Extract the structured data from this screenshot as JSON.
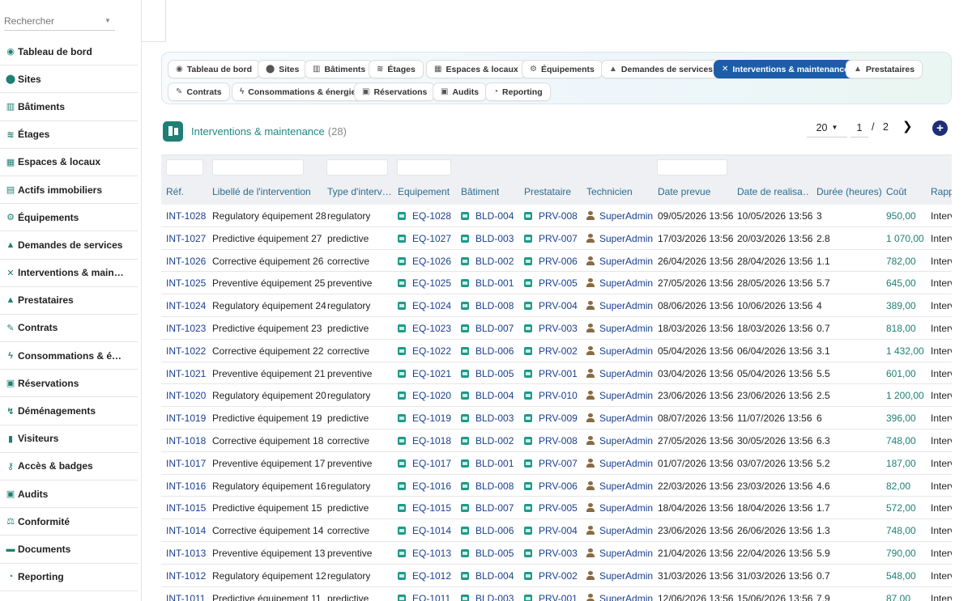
{
  "search": {
    "placeholder": "Rechercher"
  },
  "sidebar": {
    "items": [
      {
        "label": "Tableau de bord",
        "icon": "dashboard-icon",
        "glyph": "◉"
      },
      {
        "label": "Sites",
        "icon": "map-pin-icon",
        "glyph": "⬤"
      },
      {
        "label": "Bâtiments",
        "icon": "building-icon",
        "glyph": "▥"
      },
      {
        "label": "Étages",
        "icon": "layers-icon",
        "glyph": "≋"
      },
      {
        "label": "Espaces & locaux",
        "icon": "grid-icon",
        "glyph": "▦"
      },
      {
        "label": "Actifs immobiliers",
        "icon": "assets-icon",
        "glyph": "▤"
      },
      {
        "label": "Équipements",
        "icon": "gears-icon",
        "glyph": "⚙"
      },
      {
        "label": "Demandes de services",
        "icon": "bell-icon",
        "glyph": "▲"
      },
      {
        "label": "Interventions & main…",
        "icon": "tools-icon",
        "glyph": "✕"
      },
      {
        "label": "Prestataires",
        "icon": "hardhat-icon",
        "glyph": "▲"
      },
      {
        "label": "Contrats",
        "icon": "contract-icon",
        "glyph": "✎"
      },
      {
        "label": "Consommations & é…",
        "icon": "bolt-icon",
        "glyph": "ϟ"
      },
      {
        "label": "Réservations",
        "icon": "calendar-icon",
        "glyph": "▣"
      },
      {
        "label": "Déménagements",
        "icon": "truck-icon",
        "glyph": "↯"
      },
      {
        "label": "Visiteurs",
        "icon": "badge-icon",
        "glyph": "▮"
      },
      {
        "label": "Accès & badges",
        "icon": "key-icon",
        "glyph": "⚷"
      },
      {
        "label": "Audits",
        "icon": "clipboard-icon",
        "glyph": "▣"
      },
      {
        "label": "Conformité",
        "icon": "scale-icon",
        "glyph": "⚖"
      },
      {
        "label": "Documents",
        "icon": "folder-icon",
        "glyph": "▬"
      },
      {
        "label": "Reporting",
        "icon": "chart-pie-icon",
        "glyph": "◔"
      }
    ]
  },
  "module_tabs": [
    {
      "label": "Tableau de bord",
      "icon": "dashboard-icon",
      "glyph": "◉",
      "active": false
    },
    {
      "label": "Sites",
      "icon": "map-pin-icon",
      "glyph": "⬤",
      "active": false
    },
    {
      "label": "Bâtiments",
      "icon": "building-icon",
      "glyph": "▥",
      "active": false
    },
    {
      "label": "Étages",
      "icon": "layers-icon",
      "glyph": "≋",
      "active": false
    },
    {
      "label": "Espaces & locaux",
      "icon": "grid-icon",
      "glyph": "▦",
      "active": false
    },
    {
      "label": "Équipements",
      "icon": "gears-icon",
      "glyph": "⚙",
      "active": false
    },
    {
      "label": "Demandes de services",
      "icon": "bell-icon",
      "glyph": "▲",
      "active": false
    },
    {
      "label": "Interventions & maintenance",
      "icon": "tools-icon",
      "glyph": "✕",
      "active": true
    },
    {
      "label": "Prestataires",
      "icon": "hardhat-icon",
      "glyph": "▲",
      "active": false
    },
    {
      "label": "Contrats",
      "icon": "contract-icon",
      "glyph": "✎",
      "active": false
    },
    {
      "label": "Consommations & énergie",
      "icon": "bolt-icon",
      "glyph": "ϟ",
      "active": false
    },
    {
      "label": "Réservations",
      "icon": "calendar-icon",
      "glyph": "▣",
      "active": false
    },
    {
      "label": "Audits",
      "icon": "clipboard-icon",
      "glyph": "▣",
      "active": false
    },
    {
      "label": "Reporting",
      "icon": "chart-pie-icon",
      "glyph": "◔",
      "active": false
    }
  ],
  "page": {
    "title": "Interventions & maintenance",
    "count": "(28)"
  },
  "pager": {
    "page_size": "20",
    "current_page": "1",
    "separator": "/",
    "total_pages": "2",
    "next_glyph": "❯",
    "add_glyph": "+"
  },
  "table": {
    "columns": [
      "Réf.",
      "Libellé de l'intervention",
      "Type d'interv…",
      "Equipement",
      "Bâtiment",
      "Prestataire",
      "Technicien",
      "Date prevue",
      "Date de realisa…",
      "Durée (heures)",
      "Coût",
      "Rapp"
    ],
    "rows": [
      [
        "INT-1028",
        "Regulatory équipement 28",
        "regulatory",
        "EQ-1028",
        "BLD-004",
        "PRV-008",
        "SuperAdmin",
        "09/05/2026 13:56",
        "10/05/2026 13:56",
        "3",
        "950,00",
        "Interv"
      ],
      [
        "INT-1027",
        "Predictive équipement 27",
        "predictive",
        "EQ-1027",
        "BLD-003",
        "PRV-007",
        "SuperAdmin",
        "17/03/2026 13:56",
        "20/03/2026 13:56",
        "2.8",
        "1 070,00",
        "Interv"
      ],
      [
        "INT-1026",
        "Corrective équipement 26",
        "corrective",
        "EQ-1026",
        "BLD-002",
        "PRV-006",
        "SuperAdmin",
        "26/04/2026 13:56",
        "28/04/2026 13:56",
        "1.1",
        "782,00",
        "Interv"
      ],
      [
        "INT-1025",
        "Preventive équipement 25",
        "preventive",
        "EQ-1025",
        "BLD-001",
        "PRV-005",
        "SuperAdmin",
        "27/05/2026 13:56",
        "28/05/2026 13:56",
        "5.7",
        "645,00",
        "Interv"
      ],
      [
        "INT-1024",
        "Regulatory équipement 24",
        "regulatory",
        "EQ-1024",
        "BLD-008",
        "PRV-004",
        "SuperAdmin",
        "08/06/2026 13:56",
        "10/06/2026 13:56",
        "4",
        "389,00",
        "Interv"
      ],
      [
        "INT-1023",
        "Predictive équipement 23",
        "predictive",
        "EQ-1023",
        "BLD-007",
        "PRV-003",
        "SuperAdmin",
        "18/03/2026 13:56",
        "18/03/2026 13:56",
        "0.7",
        "818,00",
        "Interv"
      ],
      [
        "INT-1022",
        "Corrective équipement 22",
        "corrective",
        "EQ-1022",
        "BLD-006",
        "PRV-002",
        "SuperAdmin",
        "05/04/2026 13:56",
        "06/04/2026 13:56",
        "3.1",
        "1 432,00",
        "Interv"
      ],
      [
        "INT-1021",
        "Preventive équipement 21",
        "preventive",
        "EQ-1021",
        "BLD-005",
        "PRV-001",
        "SuperAdmin",
        "03/04/2026 13:56",
        "05/04/2026 13:56",
        "5.5",
        "601,00",
        "Interv"
      ],
      [
        "INT-1020",
        "Regulatory équipement 20",
        "regulatory",
        "EQ-1020",
        "BLD-004",
        "PRV-010",
        "SuperAdmin",
        "23/06/2026 13:56",
        "23/06/2026 13:56",
        "2.5",
        "1 200,00",
        "Interv"
      ],
      [
        "INT-1019",
        "Predictive équipement 19",
        "predictive",
        "EQ-1019",
        "BLD-003",
        "PRV-009",
        "SuperAdmin",
        "08/07/2026 13:56",
        "11/07/2026 13:56",
        "6",
        "396,00",
        "Interv"
      ],
      [
        "INT-1018",
        "Corrective équipement 18",
        "corrective",
        "EQ-1018",
        "BLD-002",
        "PRV-008",
        "SuperAdmin",
        "27/05/2026 13:56",
        "30/05/2026 13:56",
        "6.3",
        "748,00",
        "Interv"
      ],
      [
        "INT-1017",
        "Preventive équipement 17",
        "preventive",
        "EQ-1017",
        "BLD-001",
        "PRV-007",
        "SuperAdmin",
        "01/07/2026 13:56",
        "03/07/2026 13:56",
        "5.2",
        "187,00",
        "Interv"
      ],
      [
        "INT-1016",
        "Regulatory équipement 16",
        "regulatory",
        "EQ-1016",
        "BLD-008",
        "PRV-006",
        "SuperAdmin",
        "22/03/2026 13:56",
        "23/03/2026 13:56",
        "4.6",
        "82,00",
        "Interv"
      ],
      [
        "INT-1015",
        "Predictive équipement 15",
        "predictive",
        "EQ-1015",
        "BLD-007",
        "PRV-005",
        "SuperAdmin",
        "18/04/2026 13:56",
        "18/04/2026 13:56",
        "1.7",
        "572,00",
        "Interv"
      ],
      [
        "INT-1014",
        "Corrective équipement 14",
        "corrective",
        "EQ-1014",
        "BLD-006",
        "PRV-004",
        "SuperAdmin",
        "23/06/2026 13:56",
        "26/06/2026 13:56",
        "1.3",
        "748,00",
        "Interv"
      ],
      [
        "INT-1013",
        "Preventive équipement 13",
        "preventive",
        "EQ-1013",
        "BLD-005",
        "PRV-003",
        "SuperAdmin",
        "21/04/2026 13:56",
        "22/04/2026 13:56",
        "5.9",
        "790,00",
        "Interv"
      ],
      [
        "INT-1012",
        "Regulatory équipement 12",
        "regulatory",
        "EQ-1012",
        "BLD-004",
        "PRV-002",
        "SuperAdmin",
        "31/03/2026 13:56",
        "31/03/2026 13:56",
        "0.7",
        "548,00",
        "Interv"
      ],
      [
        "INT-1011",
        "Predictive équipement 11",
        "predictive",
        "EQ-1011",
        "BLD-003",
        "PRV-001",
        "SuperAdmin",
        "12/06/2026 13:56",
        "15/06/2026 13:56",
        "7.9",
        "87,00",
        "Interv"
      ]
    ]
  },
  "colors": {
    "accent_teal": "#1f7f74",
    "active_tab": "#1d5da8",
    "link_blue": "#1a3f8f",
    "add_button": "#1d2d78"
  }
}
